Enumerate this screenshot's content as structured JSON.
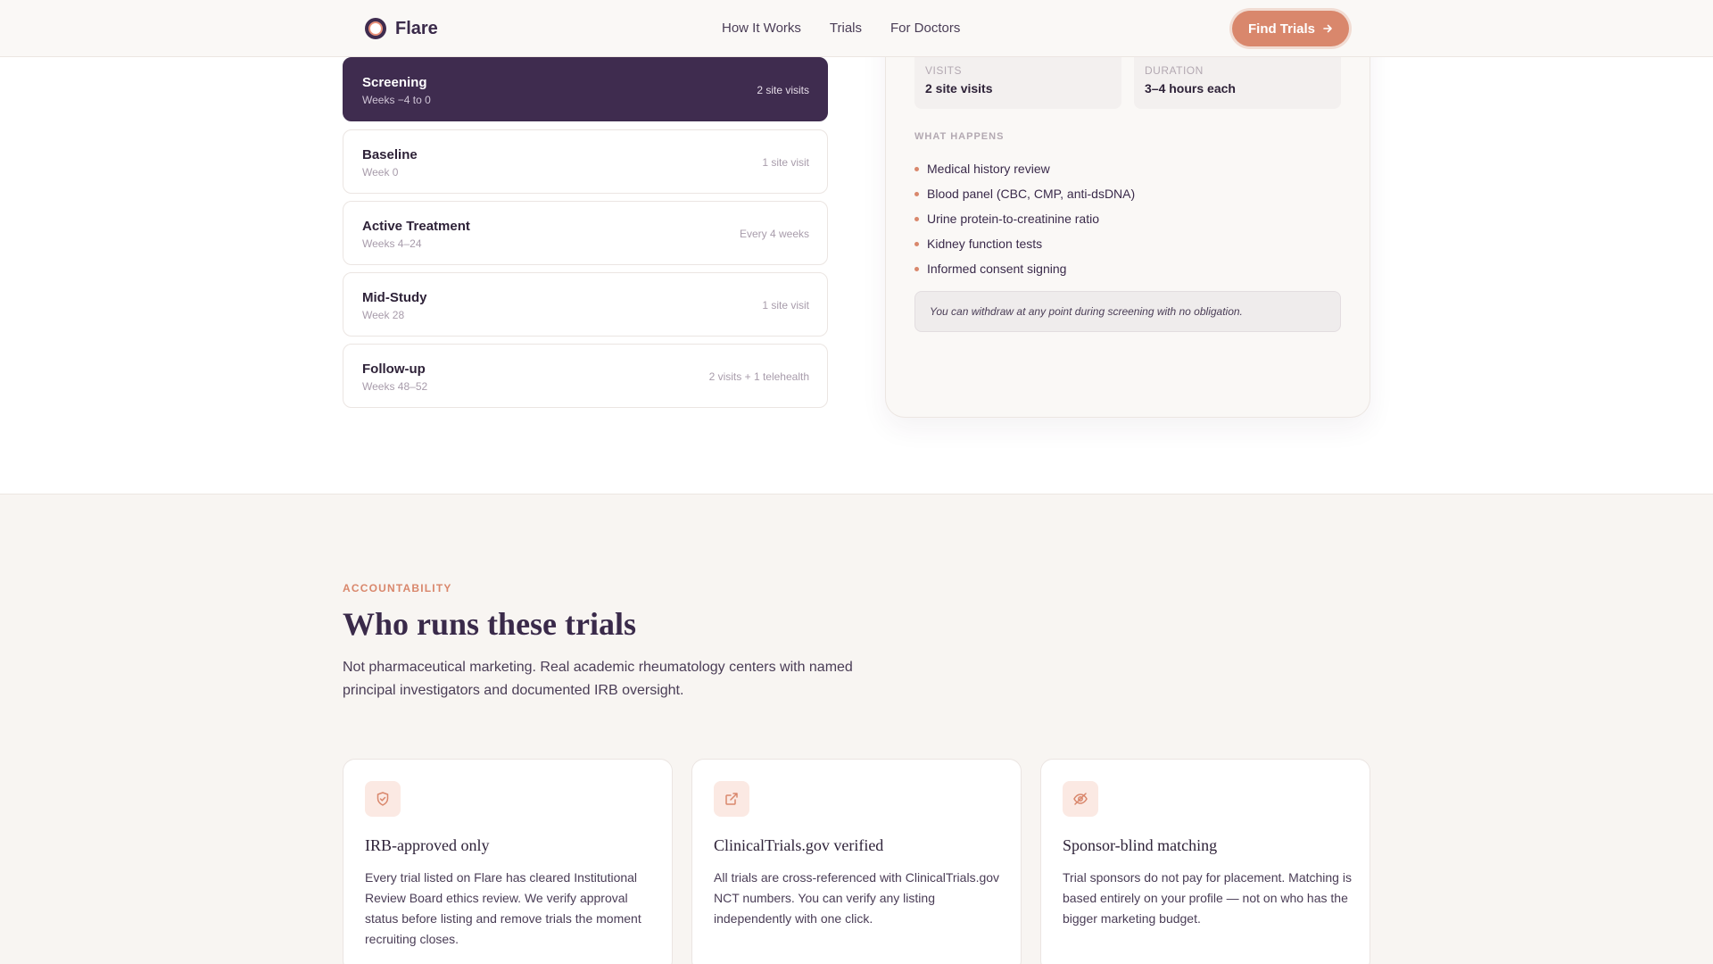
{
  "header": {
    "logo_text": "Flare",
    "nav": [
      "How It Works",
      "Trials",
      "For Doctors"
    ],
    "cta_label": "Find Trials"
  },
  "phases": [
    {
      "name": "Screening",
      "weeks": "Weeks −4 to 0",
      "meta": "2 site visits",
      "active": true
    },
    {
      "name": "Baseline",
      "weeks": "Week 0",
      "meta": "1 site visit",
      "active": false
    },
    {
      "name": "Active Treatment",
      "weeks": "Weeks 4–24",
      "meta": "Every 4 weeks",
      "active": false
    },
    {
      "name": "Mid-Study",
      "weeks": "Week 28",
      "meta": "1 site visit",
      "active": false
    },
    {
      "name": "Follow-up",
      "weeks": "Weeks 48–52",
      "meta": "2 visits + 1 telehealth",
      "active": false
    }
  ],
  "detail": {
    "visits_label": "VISITS",
    "visits_value": "2 site visits",
    "duration_label": "DURATION",
    "duration_value": "3–4 hours each",
    "what_happens_title": "WHAT HAPPENS",
    "items": [
      "Medical history review",
      "Blood panel (CBC, CMP, anti-dsDNA)",
      "Urine protein-to-creatinine ratio",
      "Kidney function tests",
      "Informed consent signing"
    ],
    "note": "You can withdraw at any point during screening with no obligation."
  },
  "accountability": {
    "eyebrow": "ACCOUNTABILITY",
    "title": "Who runs these trials",
    "description": "Not pharmaceutical marketing. Real academic rheumatology centers with named principal investigators and documented IRB oversight.",
    "cards": [
      {
        "icon": "shield-check-icon",
        "title": "IRB-approved only",
        "text": "Every trial listed on Flare has cleared Institutional Review Board ethics review. We verify approval status before listing and remove trials the moment recruiting closes."
      },
      {
        "icon": "external-link-icon",
        "title": "ClinicalTrials.gov verified",
        "text": "All trials are cross-referenced with ClinicalTrials.gov NCT numbers. You can verify any listing independently with one click."
      },
      {
        "icon": "eye-off-icon",
        "title": "Sponsor-blind matching",
        "text": "Trial sponsors do not pay for placement. Matching is based entirely on your profile — not on who has the bigger marketing budget."
      }
    ]
  },
  "colors": {
    "accent": "#d9876c",
    "brand_dark": "#3f2c4f",
    "background_alt": "#f8f5f2"
  }
}
